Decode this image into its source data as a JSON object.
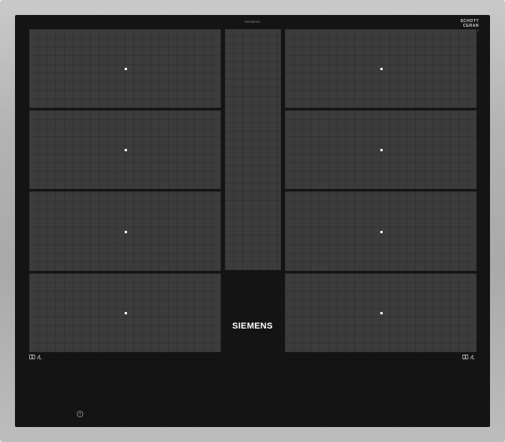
{
  "product": {
    "brand": "SIEMENS",
    "top_label": "SIEMENS",
    "logo_line1": "SCHOTT",
    "logo_line2": "CERAN",
    "logo_line3": "®"
  },
  "cooking_zones": {
    "left": [
      "left-zone-1",
      "left-zone-2",
      "left-zone-3",
      "left-zone-4"
    ],
    "right": [
      "right-zone-1",
      "right-zone-2",
      "right-zone-3",
      "right-zone-4"
    ]
  },
  "icons": {
    "flex_zone_left": "flex-zone-icon",
    "flex_zone_right": "flex-zone-icon",
    "power": "power-icon"
  },
  "colors": {
    "glass": "#141414",
    "zone": "#3c3c3c",
    "frame": "#b5b5b5",
    "marker": "#f2f2f2"
  }
}
